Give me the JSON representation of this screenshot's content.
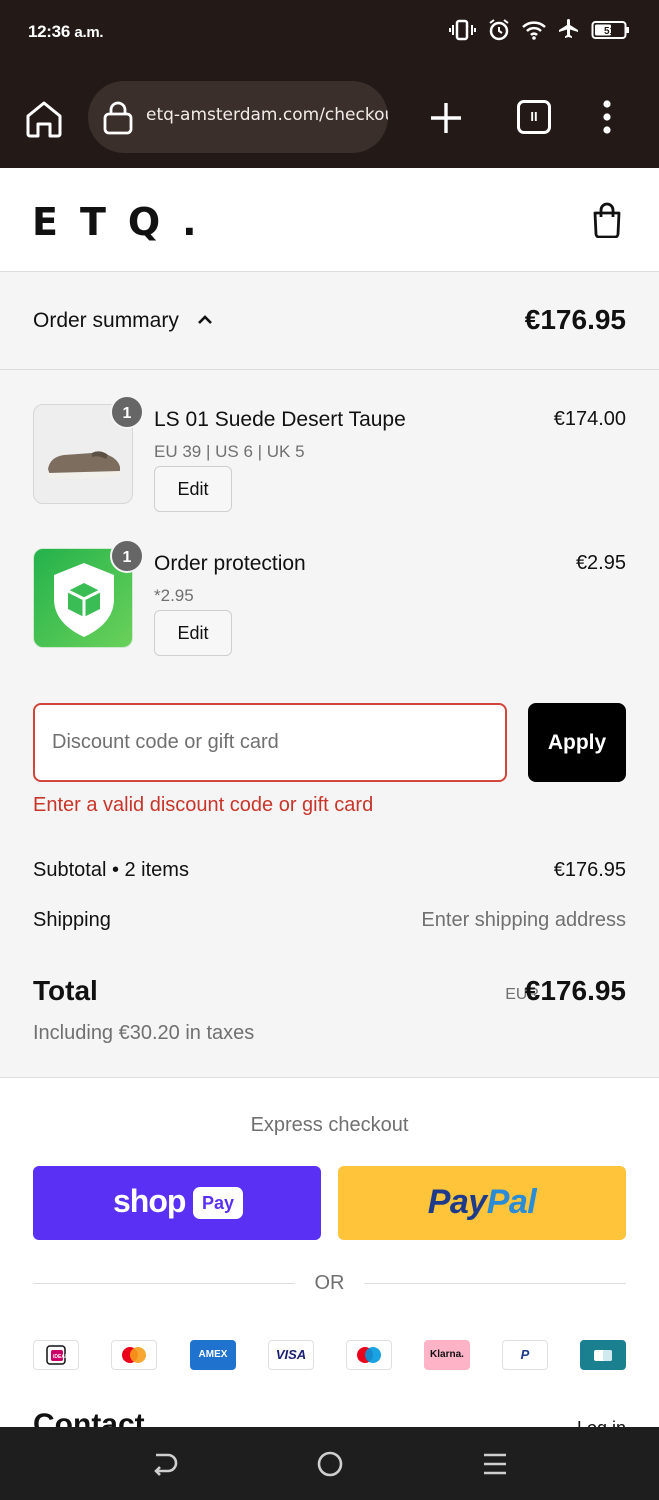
{
  "status_bar": {
    "time": "12:36",
    "ampm": "a.m.",
    "battery": "51",
    "icons": [
      "vibrate-icon",
      "alarm-icon",
      "wifi-icon",
      "airplane-icon",
      "battery-icon"
    ]
  },
  "browser": {
    "url": "etq-amsterdam.com/checkout",
    "tab_count": "II"
  },
  "header": {
    "logo": "ETQ."
  },
  "summary": {
    "toggle_label": "Order summary",
    "total": "€176.95",
    "items": [
      {
        "quantity": "1",
        "name": "LS 01 Suede Desert Taupe",
        "variant": "EU 39 | US 6 | UK 5",
        "price": "€174.00",
        "edit_label": "Edit"
      },
      {
        "quantity": "1",
        "name": "Order protection",
        "variant": "*2.95",
        "price": "€2.95",
        "edit_label": "Edit"
      }
    ],
    "discount": {
      "placeholder": "Discount code or gift card",
      "value": "",
      "apply_label": "Apply",
      "error": "Enter a valid discount code or gift card"
    },
    "subtotal_label": "Subtotal • 2 items",
    "subtotal_value": "€176.95",
    "shipping_label": "Shipping",
    "shipping_value": "Enter shipping address",
    "total_label": "Total",
    "total_currency": "EUR",
    "total_value": "€176.95",
    "tax_note": "Including €30.20 in taxes"
  },
  "express": {
    "title": "Express checkout",
    "shoppay_word": "shop",
    "shoppay_pill": "Pay",
    "paypal_part1": "Pay",
    "paypal_part2": "Pal",
    "or_text": "OR",
    "payment_methods": [
      "iDEAL",
      "Mastercard",
      "AMEX",
      "VISA",
      "Maestro",
      "Klarna.",
      "PayPal",
      "CB"
    ]
  },
  "contact": {
    "title": "Contact",
    "login": "Log in"
  },
  "colors": {
    "shoppay": "#5a31f4",
    "paypal": "#ffc43a",
    "error": "#d0453c",
    "apply": "#000000"
  }
}
